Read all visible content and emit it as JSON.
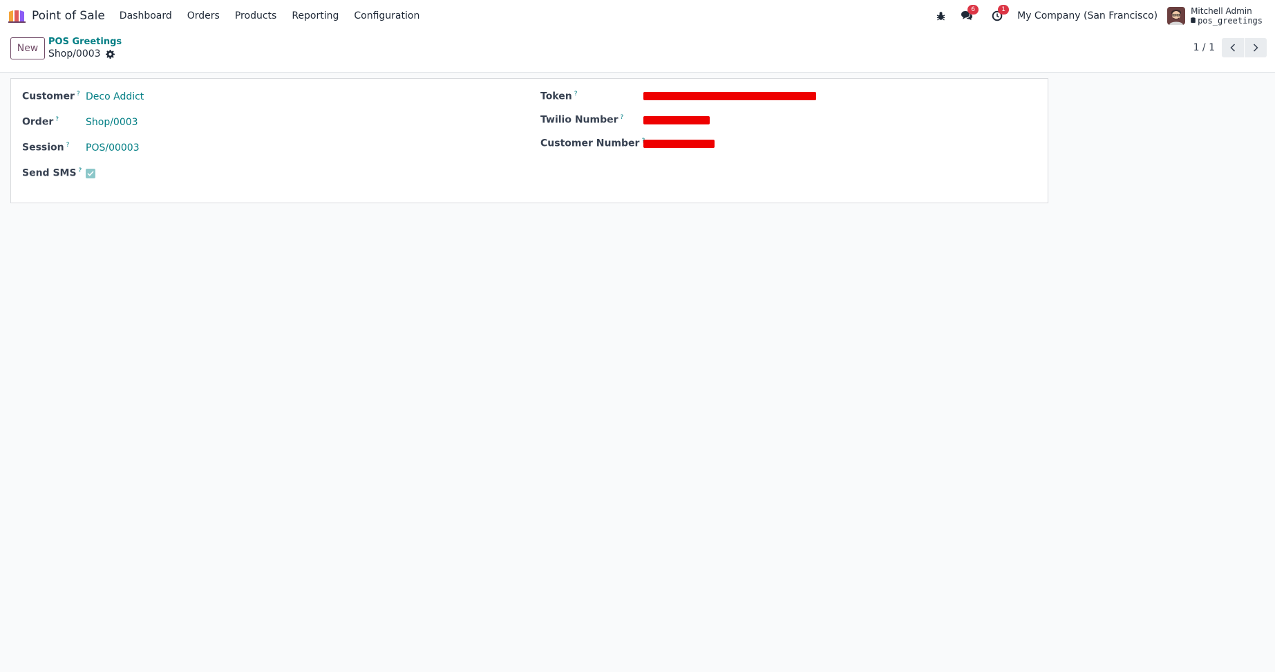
{
  "navbar": {
    "app_name": "Point of Sale",
    "menu": [
      "Dashboard",
      "Orders",
      "Products",
      "Reporting",
      "Configuration"
    ],
    "messages_badge": "6",
    "activities_badge": "1",
    "company": "My Company (San Francisco)",
    "user_name": "Mitchell Admin",
    "database": "pos_greetings"
  },
  "control_panel": {
    "new_label": "New",
    "breadcrumb_parent": "POS Greetings",
    "breadcrumb_current": "Shop/0003",
    "pager_value": "1 / 1"
  },
  "form": {
    "customer_label": "Customer",
    "customer_value": "Deco Addict",
    "order_label": "Order",
    "order_value": "Shop/0003",
    "session_label": "Session",
    "session_value": "POS/00003",
    "send_sms_label": "Send SMS",
    "send_sms_checked": true,
    "token_label": "Token",
    "twilio_label": "Twilio Number",
    "customer_number_label": "Customer Number",
    "help_mark": "?"
  },
  "colors": {
    "brand_purple": "#714b67",
    "link_teal": "#017e84",
    "badge_red": "#dc3545",
    "redaction_red": "#ee0000"
  }
}
